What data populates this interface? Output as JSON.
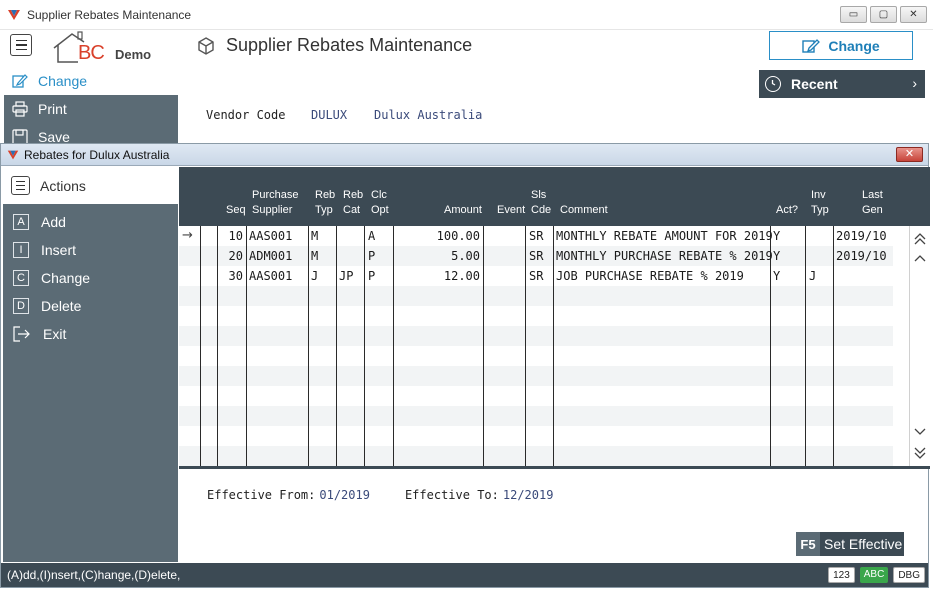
{
  "window": {
    "title": "Supplier Rebates Maintenance",
    "btn_minimize": "▭",
    "btn_restore": "▢",
    "btn_close": "✕"
  },
  "header": {
    "brand_text": "BC",
    "brand_sub": "Demo",
    "page_title": "Supplier Rebates Maintenance",
    "change_label": "Change",
    "recent_label": "Recent",
    "recent_chevron": "›"
  },
  "outer_sidebar": {
    "items": [
      {
        "label": "Change",
        "icon": "edit-icon"
      },
      {
        "label": "Print",
        "icon": "printer-icon"
      },
      {
        "label": "Save",
        "icon": "save-icon"
      }
    ]
  },
  "vendor": {
    "label": "Vendor Code",
    "code": "DULUX",
    "name": "Dulux Australia"
  },
  "dialog": {
    "title": "Rebates for Dulux Australia",
    "close": "✕",
    "actions_label": "Actions",
    "actions": [
      {
        "key": "A",
        "label": "Add"
      },
      {
        "key": "I",
        "label": "Insert"
      },
      {
        "key": "C",
        "label": "Change"
      },
      {
        "key": "D",
        "label": "Delete"
      },
      {
        "key": "",
        "label": "Exit"
      }
    ]
  },
  "grid": {
    "headers": {
      "seq": "Seq",
      "supplier_1": "Purchase",
      "supplier_2": "Supplier",
      "rebtyp_1": "Reb",
      "rebtyp_2": "Typ",
      "rebcat_1": "Reb",
      "rebcat_2": "Cat",
      "clcopt_1": "Clc",
      "clcopt_2": "Opt",
      "amount": "Amount",
      "event": "Event",
      "slscde_1": "Sls",
      "slscde_2": "Cde",
      "comment": "Comment",
      "act": "Act?",
      "invtyp_1": "Inv",
      "invtyp_2": "Typ",
      "lastgen_1": "Last",
      "lastgen_2": "Gen"
    },
    "pointer": "→",
    "rows": [
      {
        "seq": "10",
        "supplier": "AAS001",
        "rebtyp": "M",
        "rebcat": "",
        "clcopt": "A",
        "amount": "100.00",
        "event": "",
        "slscde": "SR",
        "comment": "MONTHLY REBATE AMOUNT FOR 2019",
        "act": "Y",
        "invtyp": "",
        "lastgen": "2019/10"
      },
      {
        "seq": "20",
        "supplier": "ADM001",
        "rebtyp": "M",
        "rebcat": "",
        "clcopt": "P",
        "amount": "5.00",
        "event": "",
        "slscde": "SR",
        "comment": "MONTHLY PURCHASE REBATE % 2019",
        "act": "Y",
        "invtyp": "",
        "lastgen": "2019/10"
      },
      {
        "seq": "30",
        "supplier": "AAS001",
        "rebtyp": "J",
        "rebcat": "JP",
        "clcopt": "P",
        "amount": "12.00",
        "event": "",
        "slscde": "SR",
        "comment": "JOB PURCHASE REBATE % 2019",
        "act": "Y",
        "invtyp": "J",
        "lastgen": ""
      }
    ]
  },
  "effective": {
    "from_label": "Effective From:",
    "from_value": "01/2019",
    "to_label": "Effective To:",
    "to_value": "12/2019"
  },
  "set_effective": {
    "key": "F5",
    "label": "Set Effective"
  },
  "status": {
    "text": "(A)dd,(I)nsert,(C)hange,(D)elete,",
    "badges": [
      "123",
      "ABC",
      "DBG"
    ]
  },
  "colors": {
    "accent": "#2a8fc7",
    "sidebar": "#5b6b75",
    "header_dark": "#3c4a54",
    "brand_red": "#d9412b"
  }
}
